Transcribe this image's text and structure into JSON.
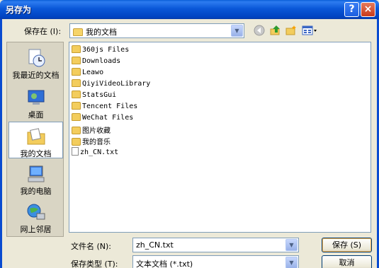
{
  "window": {
    "title": "另存为",
    "help_label": "?",
    "close_label": "×"
  },
  "toolbar": {
    "savein_label": "保存在 (I):",
    "savein_value": "我的文档",
    "icons": [
      "back-icon",
      "up-folder-icon",
      "new-folder-icon",
      "view-menu-icon"
    ]
  },
  "places": [
    {
      "label": "我最近的文档",
      "icon": "recent-documents-icon"
    },
    {
      "label": "桌面",
      "icon": "desktop-icon"
    },
    {
      "label": "我的文档",
      "icon": "my-documents-icon",
      "selected": true
    },
    {
      "label": "我的电脑",
      "icon": "my-computer-icon"
    },
    {
      "label": "网上邻居",
      "icon": "network-places-icon"
    }
  ],
  "files": [
    {
      "name": "360js Files",
      "type": "folder"
    },
    {
      "name": "Downloads",
      "type": "folder"
    },
    {
      "name": "Leawo",
      "type": "folder"
    },
    {
      "name": "QiyiVideoLibrary",
      "type": "folder"
    },
    {
      "name": "StatsGui",
      "type": "folder"
    },
    {
      "name": "Tencent Files",
      "type": "folder"
    },
    {
      "name": "WeChat Files",
      "type": "folder"
    },
    {
      "name": "图片收藏",
      "type": "special-folder"
    },
    {
      "name": "我的音乐",
      "type": "special-folder"
    },
    {
      "name": "zh_CN.txt",
      "type": "text-file"
    }
  ],
  "filename": {
    "label": "文件名 (N):",
    "value": "zh_CN.txt"
  },
  "filetype": {
    "label": "保存类型 (T):",
    "value": "文本文档 (*.txt)"
  },
  "buttons": {
    "save": "保存 (S)",
    "cancel": "取消"
  }
}
